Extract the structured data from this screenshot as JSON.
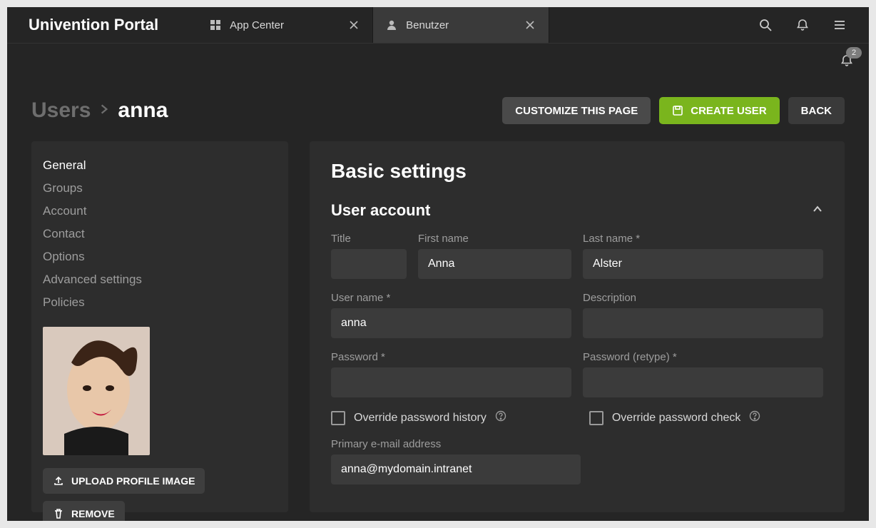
{
  "brand": "Univention Portal",
  "tabs": [
    {
      "icon": "apps-icon",
      "label": "App Center",
      "active": false
    },
    {
      "icon": "user-icon",
      "label": "Benutzer",
      "active": true
    }
  ],
  "notifications": {
    "count": "2"
  },
  "breadcrumb": {
    "root": "Users",
    "current": "anna"
  },
  "page_actions": {
    "customize": "CUSTOMIZE THIS PAGE",
    "create": "CREATE USER",
    "back": "BACK"
  },
  "sidebar": {
    "nav": [
      {
        "label": "General",
        "active": true
      },
      {
        "label": "Groups",
        "active": false
      },
      {
        "label": "Account",
        "active": false
      },
      {
        "label": "Contact",
        "active": false
      },
      {
        "label": "Options",
        "active": false
      },
      {
        "label": "Advanced settings",
        "active": false
      },
      {
        "label": "Policies",
        "active": false
      }
    ],
    "upload_label": "UPLOAD PROFILE IMAGE",
    "remove_label": "REMOVE"
  },
  "main": {
    "title": "Basic settings",
    "section_title": "User account",
    "fields": {
      "title_label": "Title",
      "title_value": "",
      "first_name_label": "First name",
      "first_name_value": "Anna",
      "last_name_label": "Last name *",
      "last_name_value": "Alster",
      "user_name_label": "User name *",
      "user_name_value": "anna",
      "description_label": "Description",
      "description_value": "",
      "password_label": "Password *",
      "password_value": "",
      "password_retype_label": "Password (retype) *",
      "password_retype_value": "",
      "override_history_label": "Override password history",
      "override_check_label": "Override password check",
      "primary_email_label": "Primary e-mail address",
      "primary_email_value": "anna@mydomain.intranet"
    }
  }
}
